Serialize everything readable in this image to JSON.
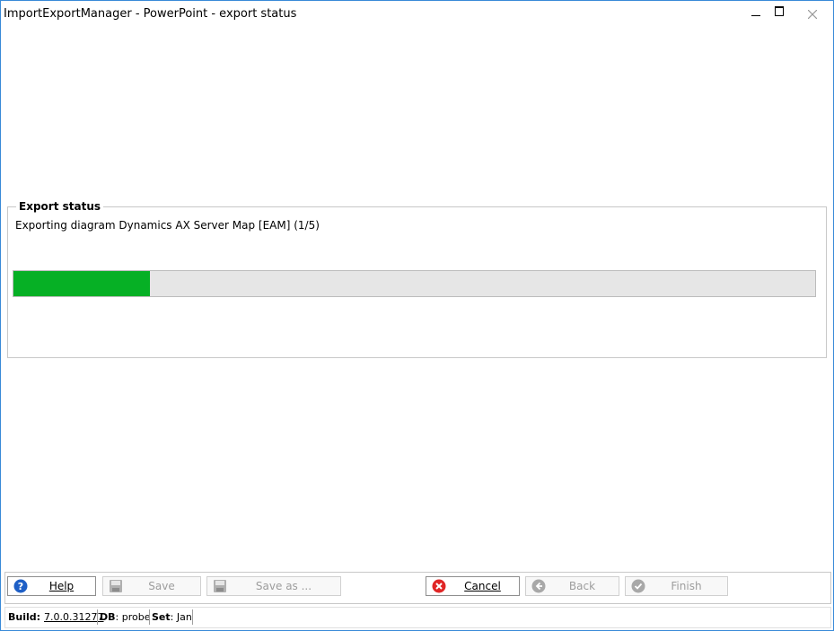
{
  "window": {
    "title": "ImportExportManager - PowerPoint - export status",
    "min_icon": "minimize-icon",
    "max_icon": "maximize-icon",
    "close_icon": "close-icon"
  },
  "export_status": {
    "group_title": "Export status",
    "message": "Exporting diagram Dynamics AX Server Map [EAM] (1/5)",
    "progress_fraction": 0.17,
    "progress_color": "#06b025"
  },
  "buttons": {
    "help": {
      "label": "Help",
      "icon": "help-icon",
      "enabled": true
    },
    "save": {
      "label": "Save",
      "icon": "save-icon",
      "enabled": false
    },
    "save_as": {
      "label": "Save as ...",
      "icon": "save-as-icon",
      "enabled": false
    },
    "cancel": {
      "label": "Cancel",
      "icon": "cancel-icon",
      "enabled": true
    },
    "back": {
      "label": "Back",
      "icon": "back-arrow-icon",
      "enabled": false
    },
    "finish": {
      "label": "Finish",
      "icon": "checkmark-icon",
      "enabled": false
    }
  },
  "statusbar": {
    "build_key": "Build:",
    "build_value": "7.0.0.31277",
    "db_key": "DB",
    "db_value": ": probe",
    "set_key": "Set",
    "set_value": ": Jan"
  },
  "colors": {
    "accent_border": "#3a8ad8",
    "help_blue": "#1e5fc6",
    "cancel_red": "#e02626",
    "disabled_gray": "#9d9d9d"
  }
}
